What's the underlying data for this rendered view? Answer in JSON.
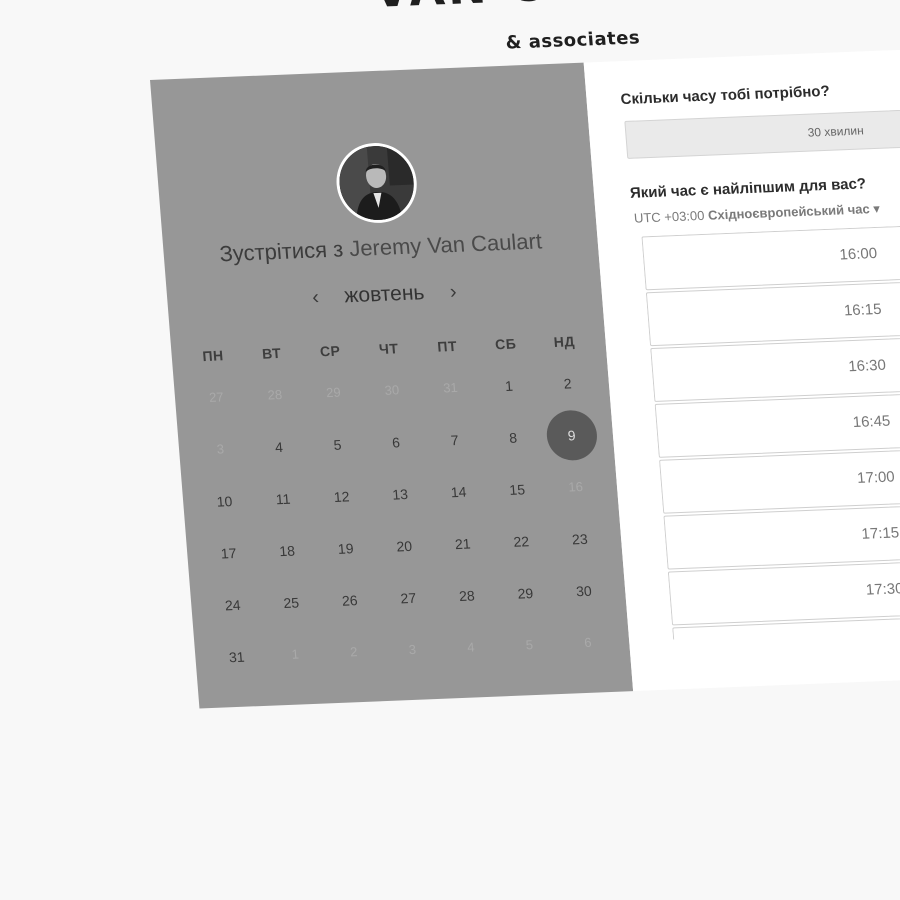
{
  "brand": {
    "name": "VAN CAULART",
    "subtitle": "& associates"
  },
  "left_panel": {
    "heading_prefix": "Зустрітися з",
    "host_name": "Jeremy Van Caulart",
    "month": "жовтень",
    "prev_icon": "‹",
    "next_icon": "›",
    "weekdays": [
      "ПН",
      "ВТ",
      "СР",
      "ЧТ",
      "ПТ",
      "СБ",
      "НД"
    ],
    "weeks": [
      [
        {
          "d": "27",
          "m": true
        },
        {
          "d": "28",
          "m": true
        },
        {
          "d": "29",
          "m": true
        },
        {
          "d": "30",
          "m": true
        },
        {
          "d": "31",
          "m": true
        },
        {
          "d": "1",
          "m": false
        },
        {
          "d": "2",
          "m": false
        }
      ],
      [
        {
          "d": "3",
          "m": true
        },
        {
          "d": "4",
          "m": false
        },
        {
          "d": "5",
          "m": false
        },
        {
          "d": "6",
          "m": false
        },
        {
          "d": "7",
          "m": false
        },
        {
          "d": "8",
          "m": false
        },
        {
          "d": "9",
          "m": false,
          "selected": true
        }
      ],
      [
        {
          "d": "10",
          "m": false
        },
        {
          "d": "11",
          "m": false
        },
        {
          "d": "12",
          "m": false
        },
        {
          "d": "13",
          "m": false
        },
        {
          "d": "14",
          "m": false
        },
        {
          "d": "15",
          "m": false
        },
        {
          "d": "16",
          "m": true
        }
      ],
      [
        {
          "d": "17",
          "m": false
        },
        {
          "d": "18",
          "m": false
        },
        {
          "d": "19",
          "m": false
        },
        {
          "d": "20",
          "m": false
        },
        {
          "d": "21",
          "m": false
        },
        {
          "d": "22",
          "m": false
        },
        {
          "d": "23",
          "m": false
        }
      ],
      [
        {
          "d": "24",
          "m": false
        },
        {
          "d": "25",
          "m": false
        },
        {
          "d": "26",
          "m": false
        },
        {
          "d": "27",
          "m": false
        },
        {
          "d": "28",
          "m": false
        },
        {
          "d": "29",
          "m": false
        },
        {
          "d": "30",
          "m": false
        }
      ],
      [
        {
          "d": "31",
          "m": false
        },
        {
          "d": "1",
          "m": true
        },
        {
          "d": "2",
          "m": true
        },
        {
          "d": "3",
          "m": true
        },
        {
          "d": "4",
          "m": true
        },
        {
          "d": "5",
          "m": true
        },
        {
          "d": "6",
          "m": true
        }
      ]
    ]
  },
  "right_panel": {
    "duration_question": "Скільки часу тобі потрібно?",
    "duration_value": "30 хвилин",
    "time_question": "Який час є найліпшим для вас?",
    "timezone_offset": "UTC +03:00",
    "timezone_name": "Східноєвропейський час",
    "timezone_caret": "▾",
    "slots": [
      "16:00",
      "16:15",
      "16:30",
      "16:45",
      "17:00",
      "17:15",
      "17:30",
      ""
    ]
  },
  "colors": {
    "left_panel_bg": "#979797",
    "selected_day_bg": "#5a5a5a",
    "page_bg": "#f8f8f8"
  }
}
